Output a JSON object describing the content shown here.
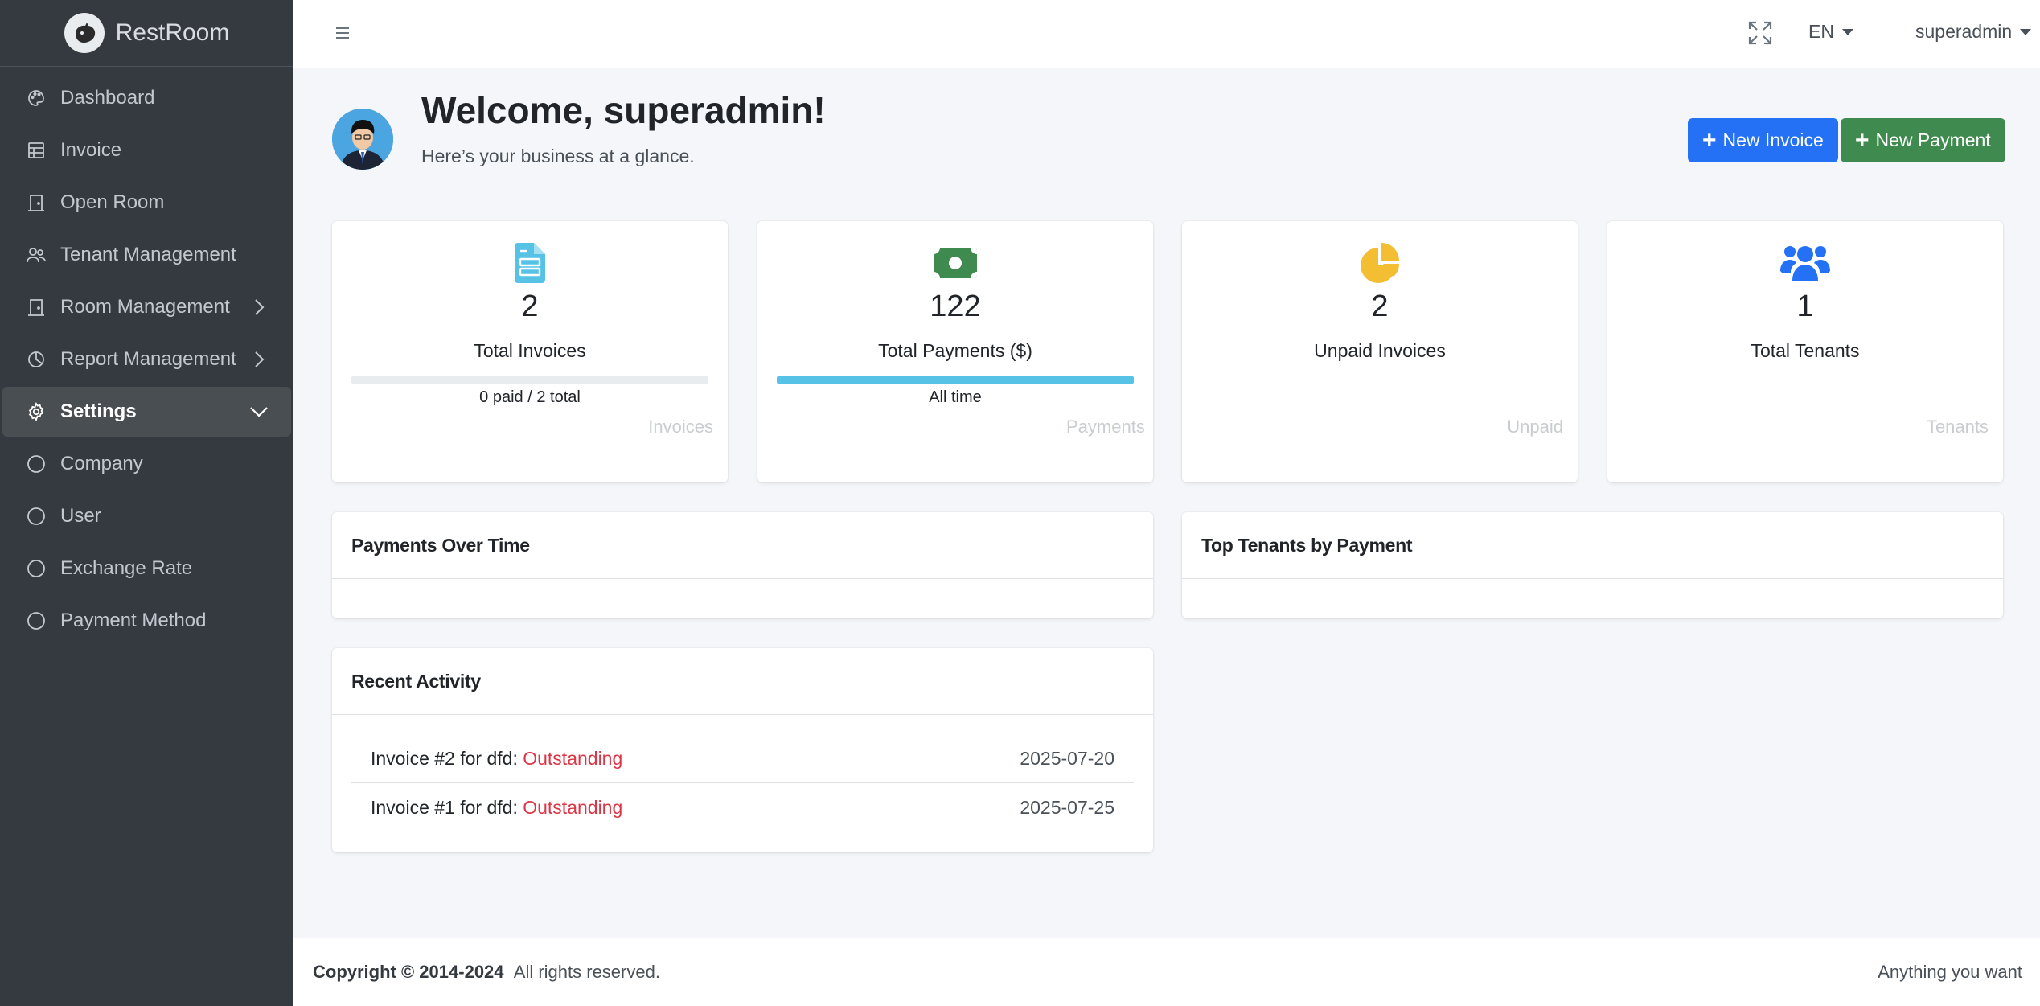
{
  "brand": {
    "name": "RestRoom",
    "logo_icon": "cat-logo-icon"
  },
  "sidebar": {
    "items": [
      {
        "label": "Dashboard",
        "icon": "palette-icon"
      },
      {
        "label": "Invoice",
        "icon": "table-icon"
      },
      {
        "label": "Open Room",
        "icon": "door-icon"
      },
      {
        "label": "Tenant Management",
        "icon": "people-icon"
      },
      {
        "label": "Room Management",
        "icon": "door-icon"
      },
      {
        "label": "Report Management",
        "icon": "pie-chart-icon"
      },
      {
        "label": "Settings",
        "icon": "gear-icon"
      },
      {
        "label": "Company",
        "icon": "circle-icon"
      },
      {
        "label": "User",
        "icon": "circle-icon"
      },
      {
        "label": "Exchange Rate",
        "icon": "circle-icon"
      },
      {
        "label": "Payment Method",
        "icon": "circle-icon"
      }
    ]
  },
  "topbar": {
    "language": "EN",
    "username": "superadmin"
  },
  "welcome": {
    "title": "Welcome, superadmin!",
    "subtitle": "Here’s your business at a glance."
  },
  "actions": {
    "new_invoice": "New Invoice",
    "new_payment": "New Payment"
  },
  "stats": [
    {
      "value": "2",
      "label": "Total Invoices",
      "foot": "0 paid / 2 total",
      "progress": 0,
      "img_alt": "Invoices",
      "icon": "file-invoice-icon",
      "color": "#55c2e6"
    },
    {
      "value": "122",
      "label": "Total Payments ($)",
      "foot": "All time",
      "progress": 1,
      "img_alt": "Payments",
      "icon": "money-bill-icon",
      "color": "#3f8a4e"
    },
    {
      "value": "2",
      "label": "Unpaid Invoices",
      "img_alt": "Unpaid",
      "icon": "pie-chart-icon",
      "color": "#f4be33"
    },
    {
      "value": "1",
      "label": "Total Tenants",
      "img_alt": "Tenants",
      "icon": "users-icon",
      "color": "#2471f5"
    }
  ],
  "panels": {
    "payments_over_time": "Payments Over Time",
    "top_tenants": "Top Tenants by Payment",
    "recent_activity": "Recent Activity"
  },
  "activity": [
    {
      "text": "Invoice #2 for dfd: ",
      "status": "Outstanding",
      "date": "2025-07-20"
    },
    {
      "text": "Invoice #1 for dfd: ",
      "status": "Outstanding",
      "date": "2025-07-25"
    }
  ],
  "footer": {
    "copyright": "Copyright © 2014-2024",
    "rights": "All rights reserved.",
    "tagline": "Anything you want"
  }
}
